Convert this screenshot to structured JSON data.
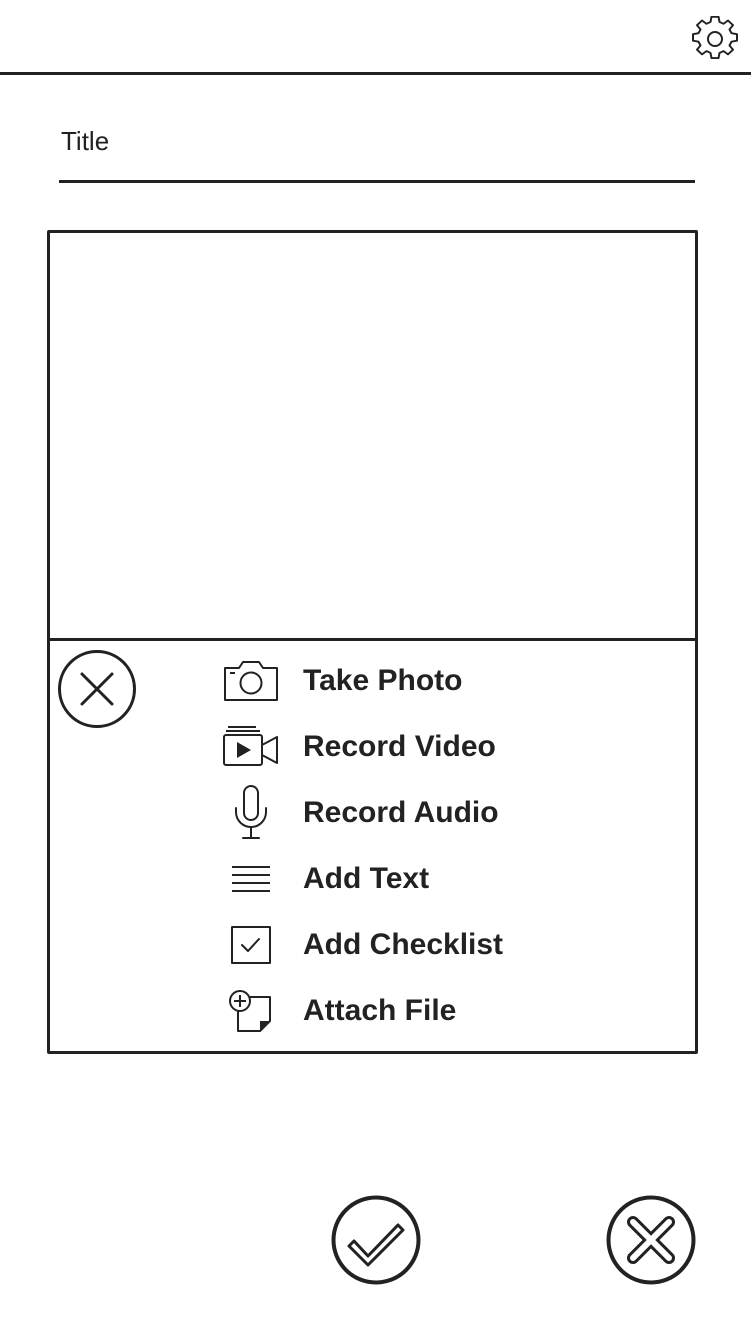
{
  "header": {
    "settings_icon": "gear-icon"
  },
  "title_field": {
    "placeholder": "Title",
    "value": ""
  },
  "add_menu": {
    "close_icon": "close-icon",
    "items": [
      {
        "label": "Take Photo",
        "icon": "camera-icon"
      },
      {
        "label": "Record Video",
        "icon": "video-camera-icon"
      },
      {
        "label": "Record Audio",
        "icon": "microphone-icon"
      },
      {
        "label": "Add Text",
        "icon": "text-lines-icon"
      },
      {
        "label": "Add Checklist",
        "icon": "checkbox-icon"
      },
      {
        "label": "Attach File",
        "icon": "attach-file-icon"
      }
    ]
  },
  "footer": {
    "confirm_icon": "checkmark-icon",
    "cancel_icon": "close-icon"
  },
  "colors": {
    "stroke": "#222222",
    "background": "#ffffff"
  }
}
